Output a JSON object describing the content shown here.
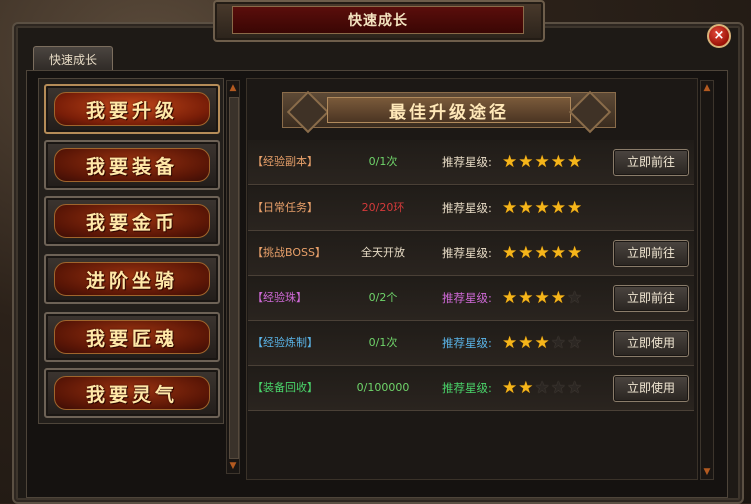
{
  "window": {
    "title": "快速成长",
    "close_label": "×"
  },
  "tab": {
    "label": "快速成长"
  },
  "menu": [
    {
      "label": "我要升级",
      "active": true
    },
    {
      "label": "我要装备",
      "active": false
    },
    {
      "label": "我要金币",
      "active": false
    },
    {
      "label": "进阶坐骑",
      "active": false
    },
    {
      "label": "我要匠魂",
      "active": false
    },
    {
      "label": "我要灵气",
      "active": false
    }
  ],
  "banner": {
    "title": "最佳升级途径"
  },
  "rows": [
    {
      "name": "【经验副本】",
      "name_color": "#e8a06a",
      "count": "0/1次",
      "count_color": "#6fd46a",
      "rec": "推荐星级:",
      "rec_color": "#e8dcc6",
      "stars": 5,
      "button": "立即前往"
    },
    {
      "name": "【日常任务】",
      "name_color": "#e8a06a",
      "count": "20/20环",
      "count_color": "#d43a3a",
      "rec": "推荐星级:",
      "rec_color": "#e8dcc6",
      "stars": 5,
      "button": ""
    },
    {
      "name": "【挑战BOSS】",
      "name_color": "#e8a06a",
      "count": "全天开放",
      "count_color": "#e8dcc6",
      "rec": "推荐星级:",
      "rec_color": "#e8dcc6",
      "stars": 5,
      "button": "立即前往"
    },
    {
      "name": "【经验珠】",
      "name_color": "#d06ad8",
      "count": "0/2个",
      "count_color": "#6fd46a",
      "rec": "推荐星级:",
      "rec_color": "#d06ad8",
      "stars": 4,
      "button": "立即前往"
    },
    {
      "name": "【经验炼制】",
      "name_color": "#5ab4e8",
      "count": "0/1次",
      "count_color": "#6fd46a",
      "rec": "推荐星级:",
      "rec_color": "#5ab4e8",
      "stars": 3,
      "button": "立即使用"
    },
    {
      "name": "【装备回收】",
      "name_color": "#4ad46a",
      "count": "0/100000",
      "count_color": "#6fd46a",
      "rec": "推荐星级:",
      "rec_color": "#4ad46a",
      "stars": 2,
      "button": "立即使用"
    }
  ],
  "max_stars": 5
}
